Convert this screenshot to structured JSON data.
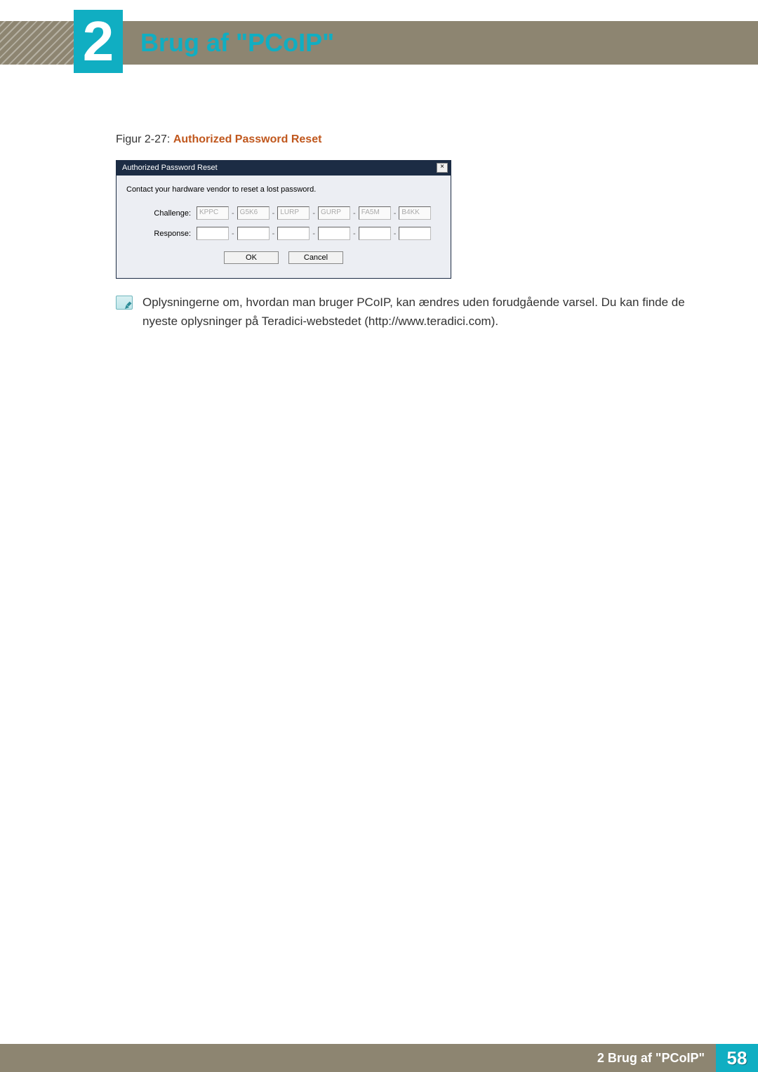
{
  "header": {
    "chapter_number": "2",
    "chapter_title": "Brug af \"PCoIP\""
  },
  "figure": {
    "caption_prefix": "Figur 2-27: ",
    "caption_title": "Authorized Password Reset"
  },
  "dialog": {
    "title": "Authorized Password Reset",
    "close_glyph": "×",
    "instruction": "Contact your hardware vendor to reset a lost password.",
    "challenge_label": "Challenge:",
    "response_label": "Response:",
    "challenge_values": [
      "KPPC",
      "G5K6",
      "LURP",
      "GURP",
      "FA5M",
      "B4KK"
    ],
    "dash": "-",
    "ok_label": "OK",
    "cancel_label": "Cancel"
  },
  "note": {
    "text": "Oplysningerne om, hvordan man bruger PCoIP, kan ændres uden forudgående varsel. Du kan finde de nyeste oplysninger på Teradici-webstedet (http://www.teradici.com)."
  },
  "footer": {
    "label": "2 Brug af \"PCoIP\"",
    "page": "58"
  }
}
